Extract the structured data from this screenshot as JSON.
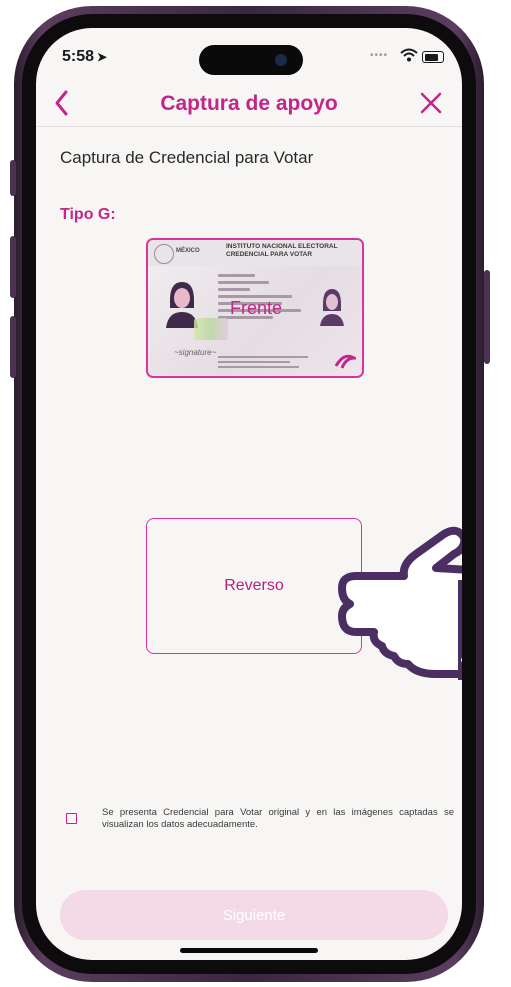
{
  "status_bar": {
    "time": "5:58",
    "location_arrow": "➤"
  },
  "nav": {
    "title": "Captura de apoyo",
    "back_icon": "chevron-left-icon",
    "close_icon": "close-icon"
  },
  "section_title": "Captura de Credencial para Votar",
  "tipo_label": "Tipo G:",
  "front_card": {
    "country": "MÉXICO",
    "institute": "INSTITUTO NACIONAL ELECTORAL",
    "credential": "CREDENCIAL PARA VOTAR",
    "label": "Frente"
  },
  "reverse_card": {
    "label": "Reverso"
  },
  "checkbox": {
    "checked": false,
    "text": "Se presenta Credencial para Votar original y en las imágenes captadas se visualizan los datos adecuadamente."
  },
  "next_button": {
    "label": "Siguiente",
    "enabled": false
  },
  "colors": {
    "accent": "#c2268b",
    "hand": "#4b2f63",
    "button_disabled": "#f4d9e7"
  }
}
